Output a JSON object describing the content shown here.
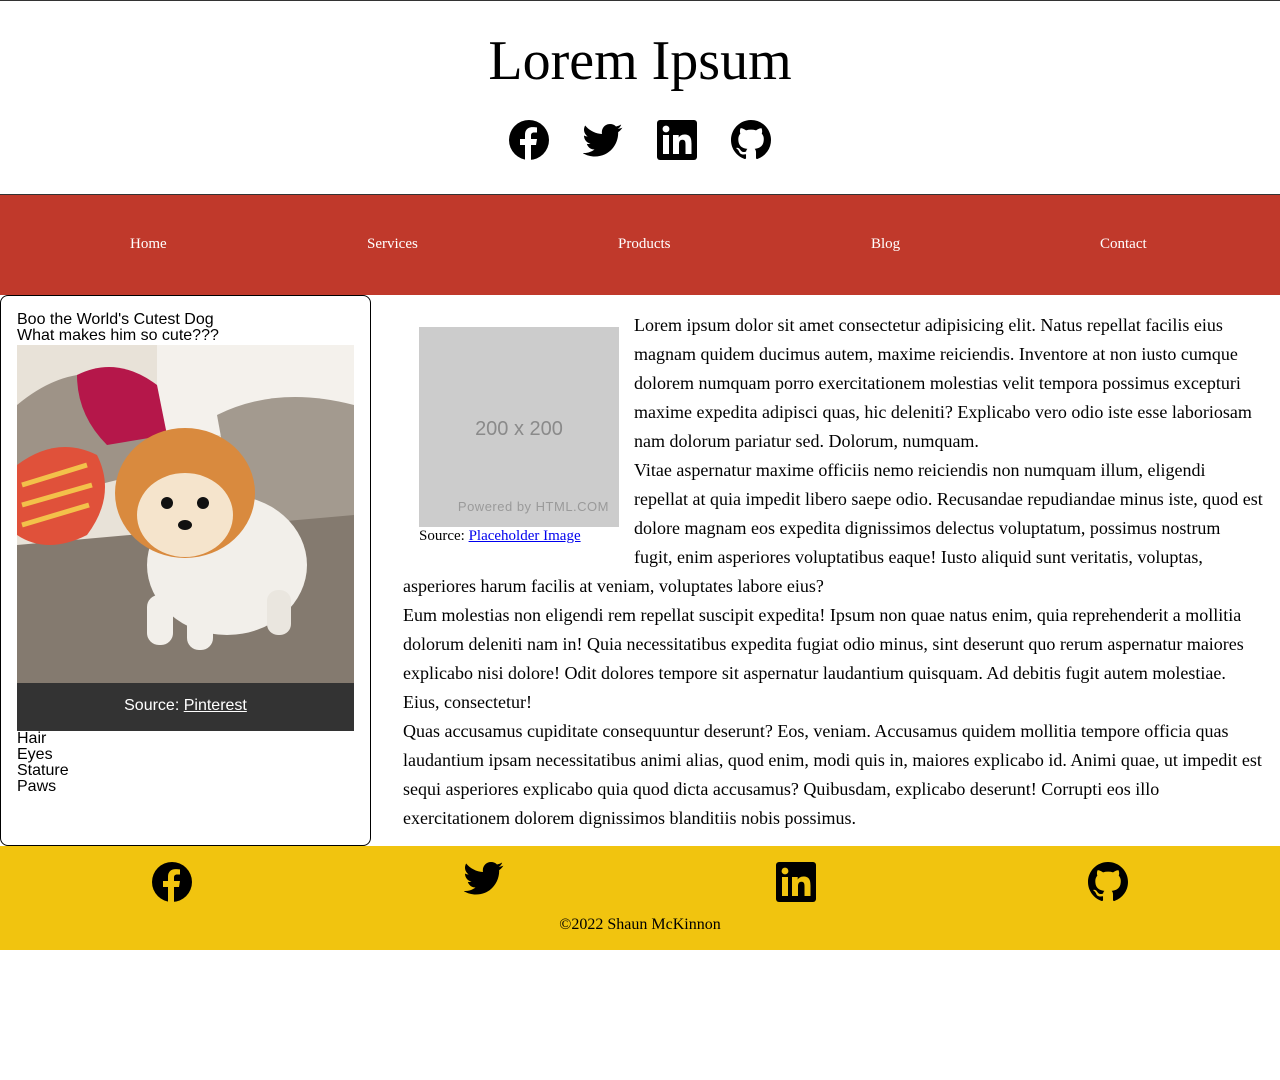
{
  "header": {
    "title": "Lorem Ipsum",
    "social": [
      "facebook-icon",
      "twitter-icon",
      "linkedin-icon",
      "github-icon"
    ]
  },
  "nav": {
    "items": [
      {
        "label": "Home"
      },
      {
        "label": "Services"
      },
      {
        "label": "Products"
      },
      {
        "label": "Blog"
      },
      {
        "label": "Contact"
      }
    ]
  },
  "sidebar": {
    "title": "Boo the World's Cutest Dog",
    "subtitle": "What makes him so cute???",
    "caption_prefix": "Source: ",
    "caption_link": "Pinterest",
    "traits": [
      "Hair",
      "Eyes",
      "Stature",
      "Paws"
    ]
  },
  "article": {
    "placeholder_size": "200 x 200",
    "placeholder_powered": "Powered by HTML.COM",
    "caption_prefix": "Source: ",
    "caption_link": "Placeholder Image",
    "paragraphs": [
      "Lorem ipsum dolor sit amet consectetur adipisicing elit. Natus repellat facilis eius magnam quidem ducimus autem, maxime reiciendis. Inventore at non iusto cumque dolorem numquam porro exercitationem molestias velit tempora possimus excepturi maxime expedita adipisci quas, hic deleniti? Explicabo vero odio iste esse laboriosam nam dolorum pariatur sed. Dolorum, numquam.",
      "Vitae aspernatur maxime officiis nemo reiciendis non numquam illum, eligendi repellat at quia impedit libero saepe odio. Recusandae repudiandae minus iste, quod est dolore magnam eos expedita dignissimos delectus voluptatum, possimus nostrum fugit, enim asperiores voluptatibus eaque! Iusto aliquid sunt veritatis, voluptas, asperiores harum facilis at veniam, voluptates labore eius?",
      "Eum molestias non eligendi rem repellat suscipit expedita! Ipsum non quae natus enim, quia reprehenderit a mollitia dolorum deleniti nam in! Quia necessitatibus expedita fugiat odio minus, sint deserunt quo rerum aspernatur maiores explicabo nisi dolore! Odit dolores tempore sit aspernatur laudantium quisquam. Ad debitis fugit autem molestiae. Eius, consectetur!",
      "Quas accusamus cupiditate consequuntur deserunt? Eos, veniam. Accusamus quidem mollitia tempore officia quas laudantium ipsam necessitatibus animi alias, quod enim, modi quis in, maiores explicabo id. Animi quae, ut impedit est sequi asperiores explicabo quia quod dicta accusamus? Quibusdam, explicabo deserunt! Corrupti eos illo exercitationem dolorem dignissimos blanditiis nobis possimus."
    ]
  },
  "footer": {
    "social": [
      "facebook-icon",
      "twitter-icon",
      "linkedin-icon",
      "github-icon"
    ],
    "copyright": "©2022 Shaun McKinnon"
  },
  "colors": {
    "nav_bg": "#c0392b",
    "footer_bg": "#f1c40f",
    "caption_bg": "#333333",
    "placeholder_bg": "#cccccc"
  }
}
